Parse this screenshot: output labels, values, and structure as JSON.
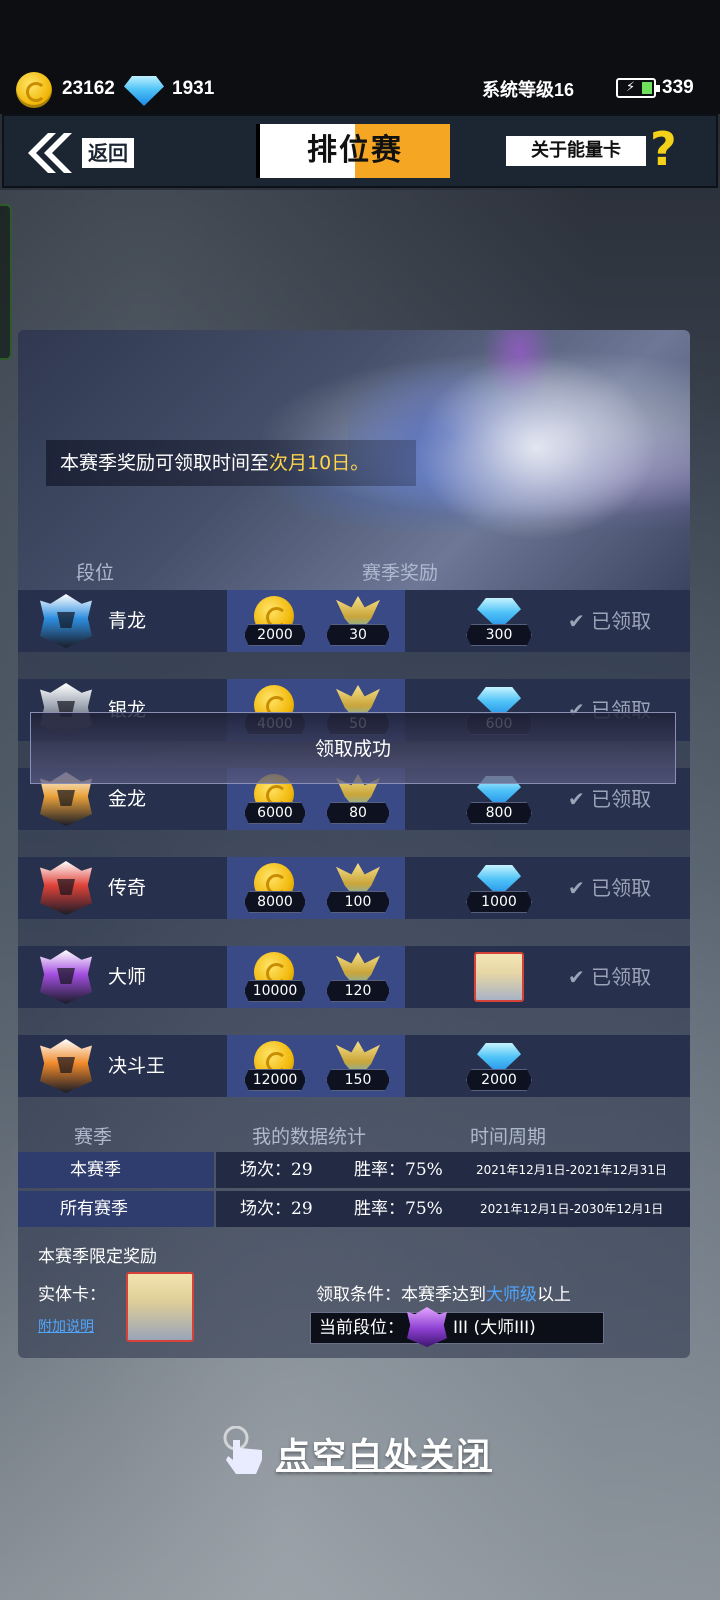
{
  "resources": {
    "coins": "23162",
    "gems": "1931",
    "system_level": "系统等级16",
    "energy": "339"
  },
  "header": {
    "back_label": "返回",
    "title": "排位赛",
    "about_label": "关于能量卡",
    "help_glyph": "?"
  },
  "banner": {
    "note_prefix": "本赛季奖励可领取时间至",
    "note_highlight": "次月10日。"
  },
  "columns": {
    "rank": "段位",
    "season_reward": "赛季奖励"
  },
  "ranks": [
    {
      "name": "青龙",
      "coins": "2000",
      "wings": "30",
      "gems": "300",
      "status": "已领取",
      "badge_color": "#2f8fe0"
    },
    {
      "name": "银龙",
      "coins": "4000",
      "wings": "50",
      "gems": "600",
      "status": "已领取",
      "badge_color": "#9aa2b0"
    },
    {
      "name": "金龙",
      "coins": "6000",
      "wings": "80",
      "gems": "800",
      "status": "已领取",
      "badge_color": "#e9a23a"
    },
    {
      "name": "传奇",
      "coins": "8000",
      "wings": "100",
      "gems": "1000",
      "status": "已领取",
      "badge_color": "#e0433a"
    },
    {
      "name": "大师",
      "coins": "10000",
      "wings": "120",
      "gems": "",
      "status": "已领取",
      "badge_color": "#a34ee0",
      "reward_card": true
    },
    {
      "name": "决斗王",
      "coins": "12000",
      "wings": "150",
      "gems": "2000",
      "status": "",
      "badge_color": "#f08a2a"
    }
  ],
  "toast": "领取成功",
  "stats": {
    "head_season": "赛季",
    "head_stats": "我的数据统计",
    "head_period": "时间周期",
    "rows": [
      {
        "season": "本赛季",
        "matches": "场次：29",
        "winrate": "胜率：75%",
        "period": "2021年12月1日-2021年12月31日"
      },
      {
        "season": "所有赛季",
        "matches": "场次：29",
        "winrate": "胜率：75%",
        "period": "2021年12月1日-2030年12月1日"
      }
    ]
  },
  "limited": {
    "title": "本赛季限定奖励",
    "card_label": "实体卡：",
    "more_link": "附加说明",
    "condition_prefix": "领取条件：本赛季达到",
    "condition_highlight": "大师级",
    "condition_suffix": "以上",
    "current_rank_label": "当前段位：",
    "current_rank_value": "III (大师III)"
  },
  "close_hint": "点空白处关闭",
  "icons": [
    "coin-icon",
    "gem-icon",
    "battery-icon",
    "back-icon",
    "help-icon",
    "rank-badge-icon",
    "wing-icon",
    "checkmark-icon",
    "tap-hand-icon"
  ]
}
